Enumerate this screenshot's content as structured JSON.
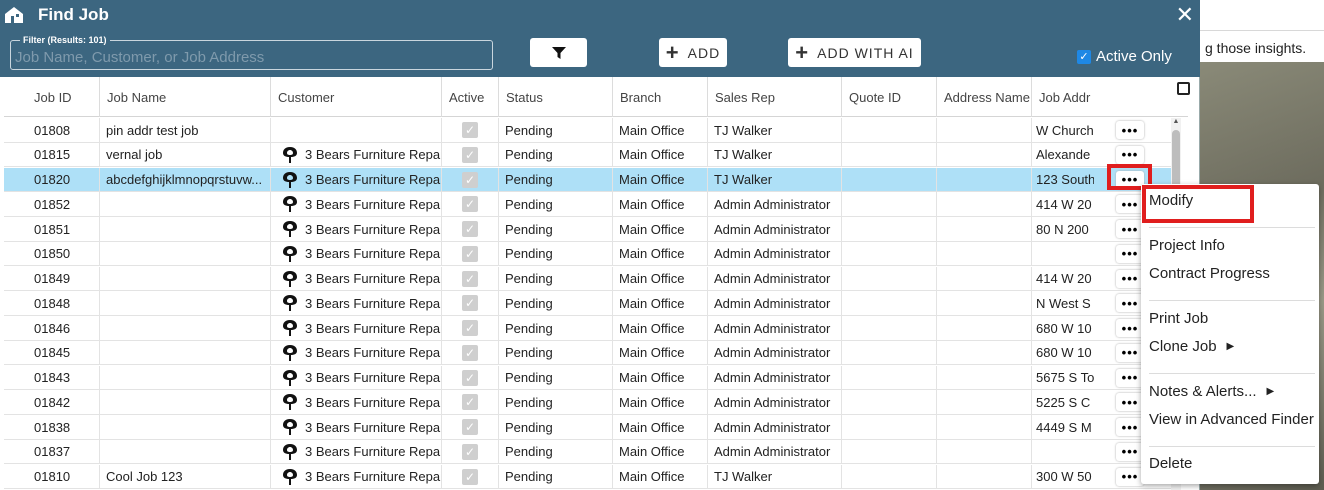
{
  "background": {
    "text": "g those insights."
  },
  "dialog": {
    "title": "Find Job",
    "close": "✕",
    "filter": {
      "legend": "Filter (Results: 101)",
      "placeholder": "Job Name, Customer, or Job Address",
      "value": ""
    },
    "buttons": {
      "add": "ADD",
      "add_with_ai": "ADD WITH AI"
    },
    "active_only": {
      "label": "Active Only",
      "checked": true
    }
  },
  "table": {
    "columns": [
      "Job ID",
      "Job Name",
      "Customer",
      "Active",
      "Status",
      "Branch",
      "Sales Rep",
      "Quote ID",
      "Address Name",
      "Job Addr"
    ],
    "rows": [
      {
        "id": "01808",
        "name": "pin addr test job",
        "customer": "",
        "status": "Pending",
        "branch": "Main Office",
        "rep": "TJ Walker",
        "quote": "",
        "addrname": "",
        "addr": "W Church",
        "selected": false
      },
      {
        "id": "01815",
        "name": "vernal job",
        "customer": "3 Bears Furniture Repai",
        "status": "Pending",
        "branch": "Main Office",
        "rep": "TJ Walker",
        "quote": "",
        "addrname": "",
        "addr": "Alexande",
        "selected": false
      },
      {
        "id": "01820",
        "name": "abcdefghijklmnopqrstuvw...",
        "customer": "3 Bears Furniture Repai",
        "status": "Pending",
        "branch": "Main Office",
        "rep": "TJ Walker",
        "quote": "",
        "addrname": "",
        "addr": "123 South",
        "selected": true
      },
      {
        "id": "01852",
        "name": "",
        "customer": "3 Bears Furniture Repai",
        "status": "Pending",
        "branch": "Main Office",
        "rep": "Admin Administrator",
        "quote": "",
        "addrname": "",
        "addr": "414 W 20",
        "selected": false
      },
      {
        "id": "01851",
        "name": "",
        "customer": "3 Bears Furniture Repai",
        "status": "Pending",
        "branch": "Main Office",
        "rep": "Admin Administrator",
        "quote": "",
        "addrname": "",
        "addr": "80 N 200",
        "selected": false
      },
      {
        "id": "01850",
        "name": "",
        "customer": "3 Bears Furniture Repai",
        "status": "Pending",
        "branch": "Main Office",
        "rep": "Admin Administrator",
        "quote": "",
        "addrname": "",
        "addr": "",
        "selected": false
      },
      {
        "id": "01849",
        "name": "",
        "customer": "3 Bears Furniture Repai",
        "status": "Pending",
        "branch": "Main Office",
        "rep": "Admin Administrator",
        "quote": "",
        "addrname": "",
        "addr": "414 W 20",
        "selected": false
      },
      {
        "id": "01848",
        "name": "",
        "customer": "3 Bears Furniture Repai",
        "status": "Pending",
        "branch": "Main Office",
        "rep": "Admin Administrator",
        "quote": "",
        "addrname": "",
        "addr": "N West S",
        "selected": false
      },
      {
        "id": "01846",
        "name": "",
        "customer": "3 Bears Furniture Repai",
        "status": "Pending",
        "branch": "Main Office",
        "rep": "Admin Administrator",
        "quote": "",
        "addrname": "",
        "addr": "680 W 10",
        "selected": false
      },
      {
        "id": "01845",
        "name": "",
        "customer": "3 Bears Furniture Repai",
        "status": "Pending",
        "branch": "Main Office",
        "rep": "Admin Administrator",
        "quote": "",
        "addrname": "",
        "addr": "680 W 10",
        "selected": false
      },
      {
        "id": "01843",
        "name": "",
        "customer": "3 Bears Furniture Repai",
        "status": "Pending",
        "branch": "Main Office",
        "rep": "Admin Administrator",
        "quote": "",
        "addrname": "",
        "addr": "5675 S To",
        "selected": false
      },
      {
        "id": "01842",
        "name": "",
        "customer": "3 Bears Furniture Repai",
        "status": "Pending",
        "branch": "Main Office",
        "rep": "Admin Administrator",
        "quote": "",
        "addrname": "",
        "addr": "5225 S C",
        "selected": false
      },
      {
        "id": "01838",
        "name": "",
        "customer": "3 Bears Furniture Repai",
        "status": "Pending",
        "branch": "Main Office",
        "rep": "Admin Administrator",
        "quote": "",
        "addrname": "",
        "addr": "4449 S M",
        "selected": false
      },
      {
        "id": "01837",
        "name": "",
        "customer": "3 Bears Furniture Repai",
        "status": "Pending",
        "branch": "Main Office",
        "rep": "Admin Administrator",
        "quote": "",
        "addrname": "",
        "addr": "",
        "selected": false
      },
      {
        "id": "01810",
        "name": "Cool Job 123",
        "customer": "3 Bears Furniture Repai",
        "status": "Pending",
        "branch": "Main Office",
        "rep": "TJ Walker",
        "quote": "",
        "addrname": "",
        "addr": "300 W 50",
        "selected": false
      }
    ],
    "row_action_label": "•••"
  },
  "context_menu": {
    "items": [
      {
        "label": "Modify",
        "arrow": false,
        "group": 0
      },
      {
        "label": "Project Info",
        "arrow": false,
        "group": 1
      },
      {
        "label": "Contract Progress",
        "arrow": false,
        "group": 1
      },
      {
        "label": "Print Job",
        "arrow": false,
        "group": 2
      },
      {
        "label": "Clone Job",
        "arrow": true,
        "group": 2
      },
      {
        "label": "Notes & Alerts...",
        "arrow": true,
        "group": 3
      },
      {
        "label": "View in Advanced Finder",
        "arrow": false,
        "group": 3
      },
      {
        "label": "Delete",
        "arrow": false,
        "group": 4
      }
    ]
  },
  "colors": {
    "header_blue": "#3c6680",
    "selected_row": "#aee0f7",
    "highlight_red": "#e01e1e"
  },
  "icons": [
    "home-icon",
    "close-icon",
    "filter-funnel-icon",
    "plus-icon",
    "checkbox-checked-icon",
    "export-icon",
    "customer-pin-icon",
    "more-dots-icon",
    "submenu-arrow-icon"
  ]
}
